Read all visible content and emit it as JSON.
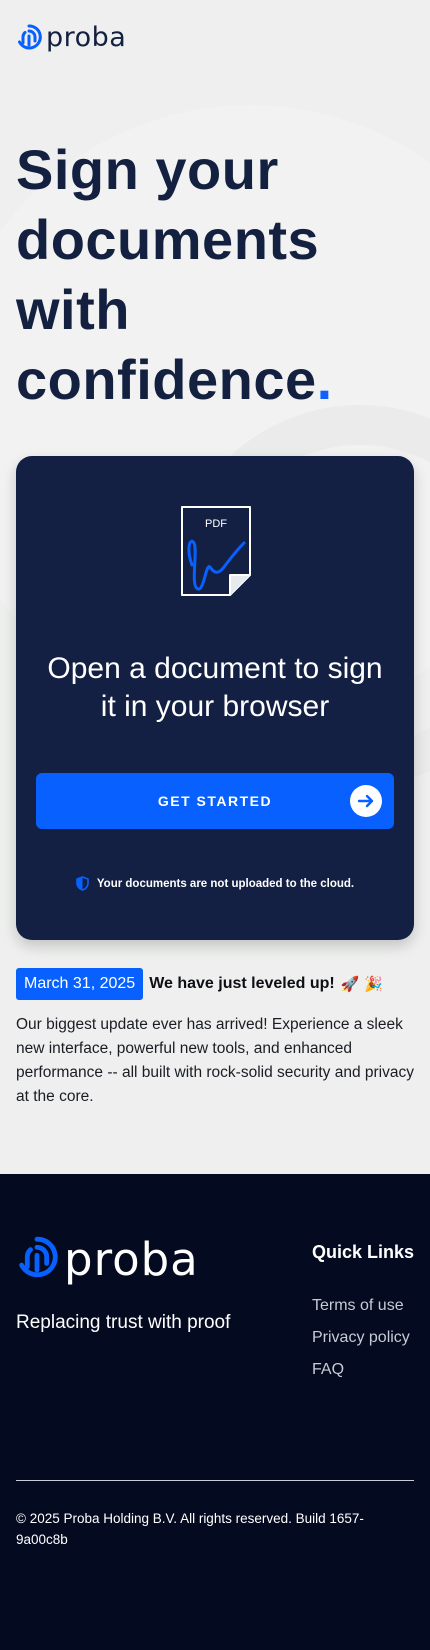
{
  "brand": {
    "name": "proba",
    "accent_color": "#0861ff",
    "navy_color": "#132044"
  },
  "hero": {
    "title": "Sign your documents with confidence",
    "title_dot": "."
  },
  "card": {
    "doc_label": "PDF",
    "headline": "Open a document to sign it in your browser",
    "cta_label": "GET STARTED",
    "cta_icon": "arrow-right-icon",
    "security_note": "Your documents are not uploaded to the cloud.",
    "security_icon": "shield-icon"
  },
  "news": {
    "date": "March 31, 2025",
    "title": "We have just leveled up!",
    "emoji": "🚀 🎉",
    "body": "Our biggest update ever has arrived! Experience a sleek new interface, powerful new tools, and enhanced performance -- all built with rock-solid security and privacy at the core."
  },
  "footer": {
    "tagline": "Replacing trust with proof",
    "quick_links_title": "Quick Links",
    "links": [
      "Terms of use",
      "Privacy policy",
      "FAQ"
    ],
    "copyright": "© 2025 Proba Holding B.V. All rights reserved. Build 1657-9a00c8b"
  }
}
